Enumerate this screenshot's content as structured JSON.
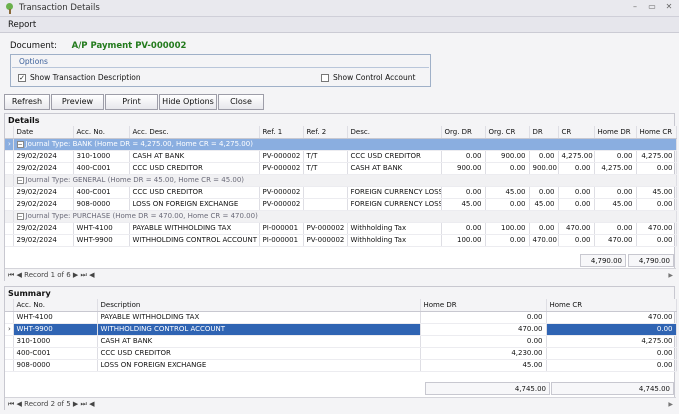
{
  "window": {
    "title": "Transaction Details",
    "minimize": "–",
    "maximize": "▭",
    "close": "✕"
  },
  "report_label": "Report",
  "document": {
    "label": "Document:",
    "value": "A/P Payment PV-000002"
  },
  "options": {
    "title": "Options",
    "show_desc": {
      "label": "Show Transaction Description",
      "checked": "✓"
    },
    "show_control": {
      "label": "Show Control Account",
      "checked": ""
    }
  },
  "buttons": {
    "refresh": "Refresh",
    "preview": "Preview",
    "print": "Print",
    "hide_options": "Hide Options",
    "close": "Close"
  },
  "details": {
    "title": "Details",
    "columns": [
      "Date",
      "Acc. No.",
      "Acc. Desc.",
      "Ref. 1",
      "Ref. 2",
      "Desc.",
      "Org. DR",
      "Org. CR",
      "DR",
      "CR",
      "Home DR",
      "Home CR"
    ],
    "groups": [
      {
        "label": "Journal Type: BANK (Home DR = 4,275.00, Home CR = 4,275.00)",
        "rows": [
          [
            "29/02/2024",
            "310-1000",
            "CASH AT BANK",
            "PV-000002",
            "T/T",
            "CCC USD CREDITOR",
            "0.00",
            "900.00",
            "0.00",
            "4,275.00",
            "0.00",
            "4,275.00"
          ],
          [
            "29/02/2024",
            "400-C001",
            "CCC USD CREDITOR",
            "PV-000002",
            "T/T",
            "CASH AT BANK",
            "900.00",
            "0.00",
            "900.00",
            "0.00",
            "4,275.00",
            "0.00"
          ]
        ]
      },
      {
        "label": "Journal Type: GENERAL (Home DR = 45.00, Home CR = 45.00)",
        "rows": [
          [
            "29/02/2024",
            "400-C001",
            "CCC USD CREDITOR",
            "PV-000002",
            "",
            "FOREIGN CURRENCY LOSS",
            "0.00",
            "45.00",
            "0.00",
            "0.00",
            "0.00",
            "45.00"
          ],
          [
            "29/02/2024",
            "908-0000",
            "LOSS ON FOREIGN EXCHANGE",
            "PV-000002",
            "",
            "FOREIGN CURRENCY LOSS",
            "45.00",
            "0.00",
            "45.00",
            "0.00",
            "45.00",
            "0.00"
          ]
        ]
      },
      {
        "label": "Journal Type: PURCHASE (Home DR = 470.00, Home CR = 470.00)",
        "rows": [
          [
            "29/02/2024",
            "WHT-4100",
            "PAYABLE WITHHOLDING TAX",
            "PI-000001",
            "PV-000002",
            "Withholding Tax",
            "0.00",
            "100.00",
            "0.00",
            "470.00",
            "0.00",
            "470.00"
          ],
          [
            "29/02/2024",
            "WHT-9900",
            "WITHHOLDING CONTROL ACCOUNT",
            "PI-000001",
            "PV-000002",
            "Withholding Tax",
            "100.00",
            "0.00",
            "470.00",
            "0.00",
            "470.00",
            "0.00"
          ]
        ]
      }
    ],
    "total_home_dr": "4,790.00",
    "total_home_cr": "4,790.00",
    "record_text": "Record 1 of 6"
  },
  "summary": {
    "title": "Summary",
    "columns": [
      "Acc. No.",
      "Description",
      "Home DR",
      "Home CR"
    ],
    "rows": [
      [
        "WHT-4100",
        "PAYABLE WITHHOLDING TAX",
        "0.00",
        "470.00"
      ],
      [
        "WHT-9900",
        "WITHHOLDING CONTROL ACCOUNT",
        "470.00",
        "0.00"
      ],
      [
        "310-1000",
        "CASH AT BANK",
        "0.00",
        "4,275.00"
      ],
      [
        "400-C001",
        "CCC USD CREDITOR",
        "4,230.00",
        "0.00"
      ],
      [
        "908-0000",
        "LOSS ON FOREIGN EXCHANGE",
        "45.00",
        "0.00"
      ]
    ],
    "total_home_dr": "4,745.00",
    "total_home_cr": "4,745.00",
    "record_text": "Record 2 of 5"
  },
  "nav": {
    "first": "⏮",
    "prev": "◀",
    "next": "▶",
    "last": "⏭",
    "scroll_left": "◀",
    "scroll_right": "▶"
  },
  "colors": {
    "accent": "#2f64b3",
    "doc_green": "#227a1c",
    "group_selected": "#8aaee0"
  }
}
